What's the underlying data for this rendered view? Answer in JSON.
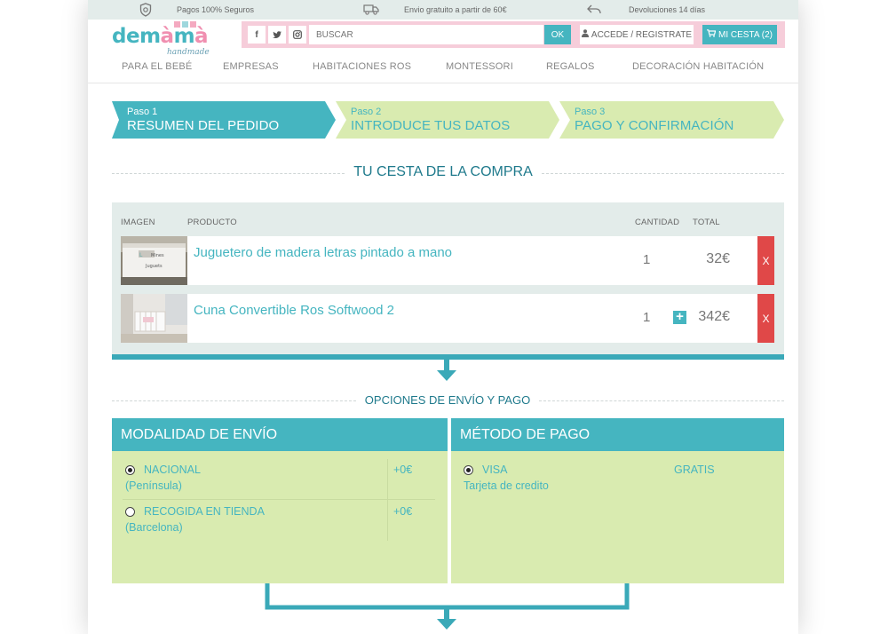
{
  "topbar": {
    "secure_payments": "Pagos 100% Seguros",
    "free_shipping": "Envio gratuito a partir de 60€",
    "returns": "Devoluciones 14 días"
  },
  "brand": {
    "name_part1": "dem",
    "name_a1": "à",
    "name_m": "m",
    "name_a2": "à",
    "sub": "handmade"
  },
  "header": {
    "social": [
      "f",
      "t",
      "ig"
    ],
    "search_placeholder": "BUSCAR",
    "search_button": "OK",
    "login_label": "ACCEDE / REGISTRATE",
    "cart_label": "MI CESTA (2)"
  },
  "nav": {
    "items": [
      "PARA EL BEBÉ",
      "EMPRESAS",
      "HABITACIONES ROS",
      "MONTESSORI",
      "REGALOS",
      "DECORACIÓN HABITACIÓN"
    ]
  },
  "steps": [
    {
      "num": "Paso 1",
      "name": "RESUMEN DEL PEDIDO",
      "active": true
    },
    {
      "num": "Paso 2",
      "name": "INTRODUCE TUS DATOS",
      "active": false
    },
    {
      "num": "Paso 3",
      "name": "PAGO Y CONFIRMACIÓN",
      "active": false
    }
  ],
  "cart": {
    "title": "TU CESTA DE LA COMPRA",
    "headers": {
      "image": "IMAGEN",
      "product": "PRODUCTO",
      "qty": "CANTIDAD",
      "total": "TOTAL"
    },
    "rows": [
      {
        "name": "Juguetero de madera letras pintado a mano",
        "qty": "1",
        "total": "32€",
        "remove": "X"
      },
      {
        "name": "Cuna Convertible Ros Softwood 2",
        "qty": "1",
        "plus": "+",
        "total": "342€",
        "remove": "X"
      }
    ]
  },
  "options": {
    "title": "OPCIONES DE ENVÍO Y PAGO",
    "shipping": {
      "header": "MODALIDAD DE ENVÍO",
      "items": [
        {
          "label": "NACIONAL",
          "sub": "(Península)",
          "price": "+0€",
          "selected": true
        },
        {
          "label": "RECOGIDA EN TIENDA",
          "sub": "(Barcelona)",
          "price": "+0€",
          "selected": false
        }
      ]
    },
    "payment": {
      "header": "MÉTODO DE PAGO",
      "items": [
        {
          "label": "VISA",
          "sub": "Tarjeta de credito",
          "price": "GRATIS",
          "selected": true
        }
      ]
    }
  },
  "colors": {
    "teal": "#45b5c0",
    "teal_dark": "#3aa9b8",
    "title_teal": "#1f7a8c",
    "step_inactive": "#d9ebb0",
    "pink": "#f6cdda",
    "remove_red": "#e04848"
  }
}
